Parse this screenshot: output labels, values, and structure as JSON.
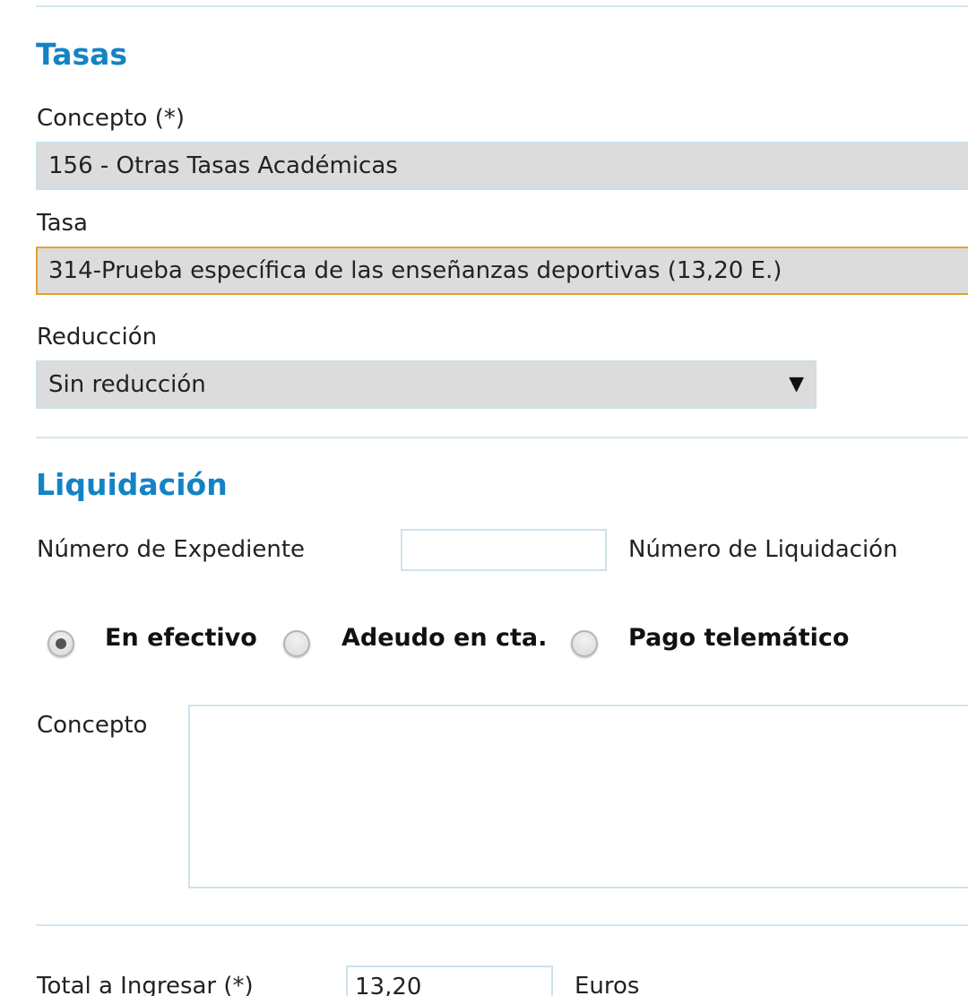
{
  "tasas": {
    "title": "Tasas",
    "concepto_label": "Concepto (*)",
    "concepto_value": "156 - Otras Tasas Académicas",
    "tasa_label": "Tasa",
    "tasa_value": "314-Prueba específica de las enseñanzas deportivas (13,20 E.)",
    "reduccion_label": "Reducción",
    "reduccion_value": "Sin reducción",
    "reduccion_arrow": "▼"
  },
  "liquidacion": {
    "title": "Liquidación",
    "expediente_label": "Número de Expediente",
    "expediente_value": "",
    "liquidacion_label": "Número de Liquidación",
    "payment_options": [
      {
        "label": "En efectivo",
        "selected": true
      },
      {
        "label": "Adeudo en cta.",
        "selected": false
      },
      {
        "label": "Pago telemático",
        "selected": false
      }
    ],
    "concepto_label": "Concepto",
    "concepto_value": "",
    "total_label": "Total a Ingresar (*)",
    "total_value": "13,20",
    "currency": "Euros"
  },
  "colors": {
    "accent": "#1483c6",
    "divider": "#d4e6ef",
    "field_bg": "#dcdcdc",
    "focus_border": "#e3a22a"
  }
}
